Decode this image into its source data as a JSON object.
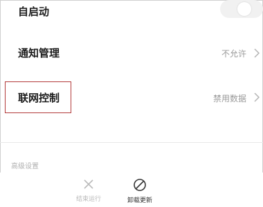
{
  "settings": {
    "autostart": {
      "label": "自启动"
    },
    "notification": {
      "label": "通知管理",
      "value": "不允许"
    },
    "network": {
      "label": "联网控制",
      "value": "禁用数据"
    },
    "advanced_section": {
      "label": "高级设置"
    }
  },
  "bottom_actions": {
    "stop": {
      "label": "结束运行",
      "icon": "close-icon"
    },
    "uninstall": {
      "label": "卸载更新",
      "icon": "prohibited-icon"
    }
  },
  "colors": {
    "highlight_border": "#b33a3a",
    "muted_text": "#9a9a9a"
  }
}
